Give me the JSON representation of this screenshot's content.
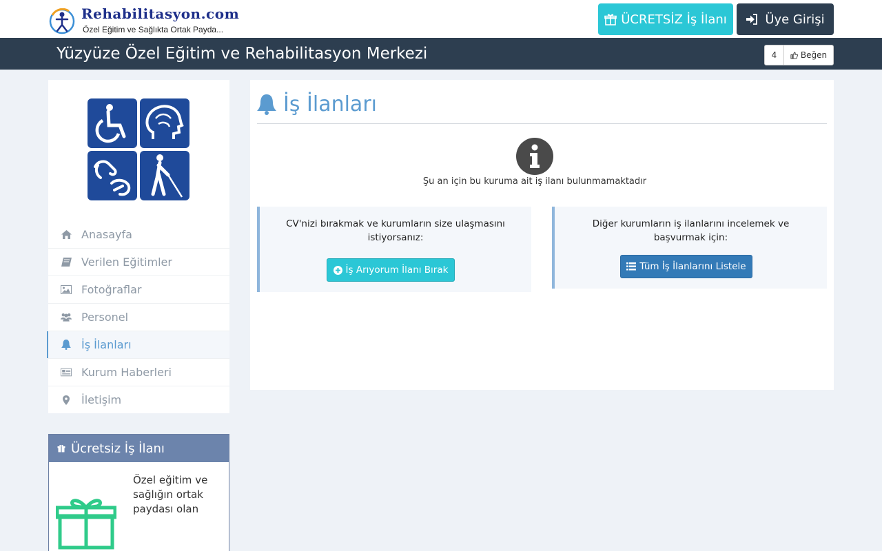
{
  "header": {
    "logo_title": "Rehabilitasyon.com",
    "logo_subtitle": "Özel Eğitim ve Sağlıkta Ortak Payda...",
    "free_ad_button": "ÜCRETSİZ İş İlanı",
    "login_button": "Üye Girişi"
  },
  "titlebar": {
    "title": "Yüzyüze Özel Eğitim ve Rehabilitasyon Merkezi",
    "like_count": "4",
    "like_label": "Beğen"
  },
  "sidebar": {
    "items": [
      {
        "label": "Anasayfa",
        "icon": "home-icon"
      },
      {
        "label": "Verilen Eğitimler",
        "icon": "book-icon"
      },
      {
        "label": "Fotoğraflar",
        "icon": "image-icon"
      },
      {
        "label": "Personel",
        "icon": "users-icon"
      },
      {
        "label": "İş İlanları",
        "icon": "bell-icon",
        "active": true
      },
      {
        "label": "Kurum Haberleri",
        "icon": "newspaper-icon"
      },
      {
        "label": "İletişim",
        "icon": "map-marker-icon"
      }
    ],
    "free_panel": {
      "title": "Ücretsiz İş İlanı",
      "text": "Özel eğitim ve sağlığın ortak paydası olan"
    }
  },
  "main": {
    "title": "İş İlanları",
    "empty_message": "Şu an için bu kuruma ait iş ilanı bulunmamaktadır",
    "left_card": {
      "text": "CV'nizi bırakmak ve kurumların size ulaşmasını istiyorsanız:",
      "button": "İş Arıyorum İlanı Bırak"
    },
    "right_card": {
      "text": "Diğer kurumların iş ilanlarını incelemek ve başvurmak için:",
      "button": "Tüm İş İlanlarını Listele"
    }
  },
  "colors": {
    "navy": "#2d3e50",
    "cyan": "#2bc7d6",
    "accent_blue": "#5b9bd0",
    "primary_blue": "#337ab7",
    "background": "#eef2f7"
  }
}
